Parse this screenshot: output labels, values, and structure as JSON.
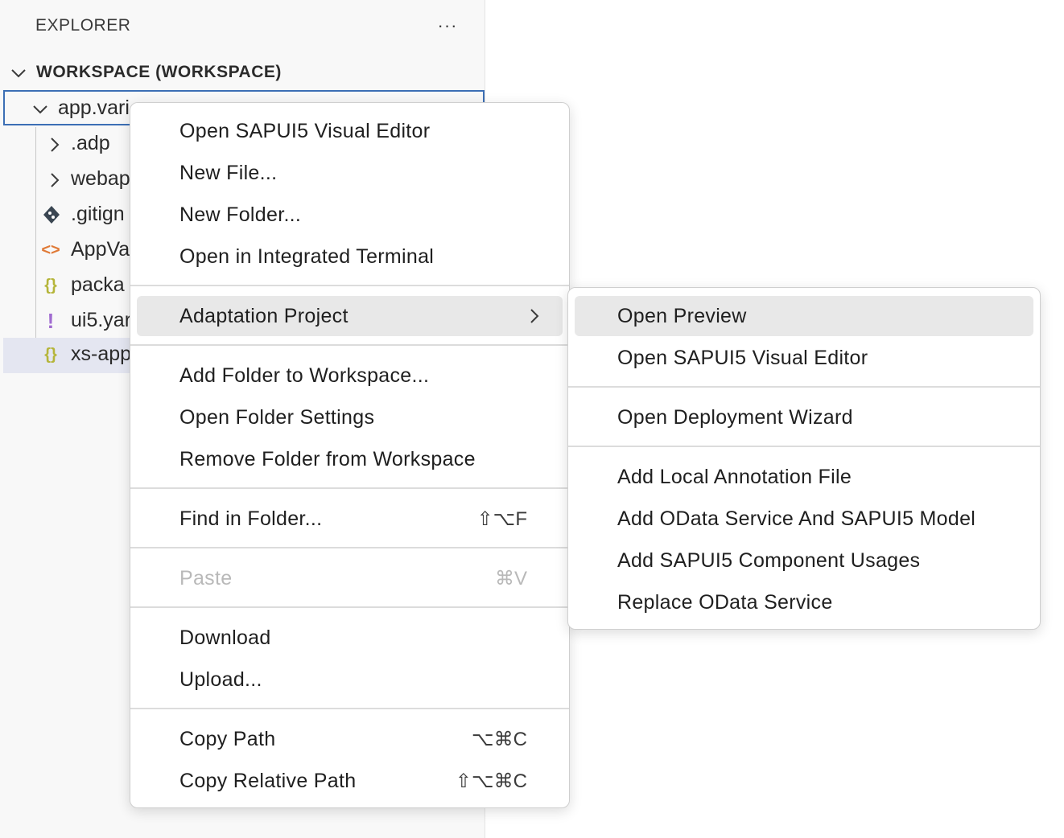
{
  "explorer": {
    "title": "EXPLORER",
    "more_label": "···",
    "workspace_label": "WORKSPACE (WORKSPACE)",
    "tree": {
      "root_label": "app.vari",
      "items": [
        {
          "label": ".adp",
          "icon": "chevron-right-icon"
        },
        {
          "label": "webap",
          "icon": "chevron-right-icon"
        },
        {
          "label": ".gitign",
          "icon": "git-diamond-icon"
        },
        {
          "label": "AppVa",
          "icon": "code-brackets-icon",
          "glyph": "<>"
        },
        {
          "label": "packa",
          "icon": "json-braces-icon",
          "glyph": "{}"
        },
        {
          "label": "ui5.yar",
          "icon": "yaml-exclamation-icon",
          "glyph": "!"
        },
        {
          "label": "xs-app",
          "icon": "json-braces-icon",
          "glyph": "{}"
        }
      ]
    }
  },
  "context_menu": {
    "items": [
      {
        "label": "Open SAPUI5 Visual Editor"
      },
      {
        "label": "New File..."
      },
      {
        "label": "New Folder..."
      },
      {
        "label": "Open in Integrated Terminal"
      },
      {
        "label": "Adaptation Project"
      },
      {
        "label": "Add Folder to Workspace..."
      },
      {
        "label": "Open Folder Settings"
      },
      {
        "label": "Remove Folder from Workspace"
      },
      {
        "label": "Find in Folder...",
        "shortcut": "⇧⌥F"
      },
      {
        "label": "Paste",
        "shortcut": "⌘V"
      },
      {
        "label": "Download"
      },
      {
        "label": "Upload..."
      },
      {
        "label": "Copy Path",
        "shortcut": "⌥⌘C"
      },
      {
        "label": "Copy Relative Path",
        "shortcut": "⇧⌥⌘C"
      }
    ]
  },
  "submenu": {
    "items": [
      {
        "label": "Open Preview"
      },
      {
        "label": "Open SAPUI5 Visual Editor"
      },
      {
        "label": "Open Deployment Wizard"
      },
      {
        "label": "Add Local Annotation File"
      },
      {
        "label": "Add OData Service And SAPUI5 Model"
      },
      {
        "label": "Add SAPUI5 Component Usages"
      },
      {
        "label": "Replace OData Service"
      }
    ]
  },
  "colors": {
    "focus_border": "#3c6fb5",
    "selected_row": "#e4e6f1",
    "menu_hover": "#e8e8e8",
    "git_icon": "#3a4652",
    "code_icon": "#e07a37",
    "json_icon": "#b5b53a",
    "yaml_icon": "#a06bd0"
  }
}
